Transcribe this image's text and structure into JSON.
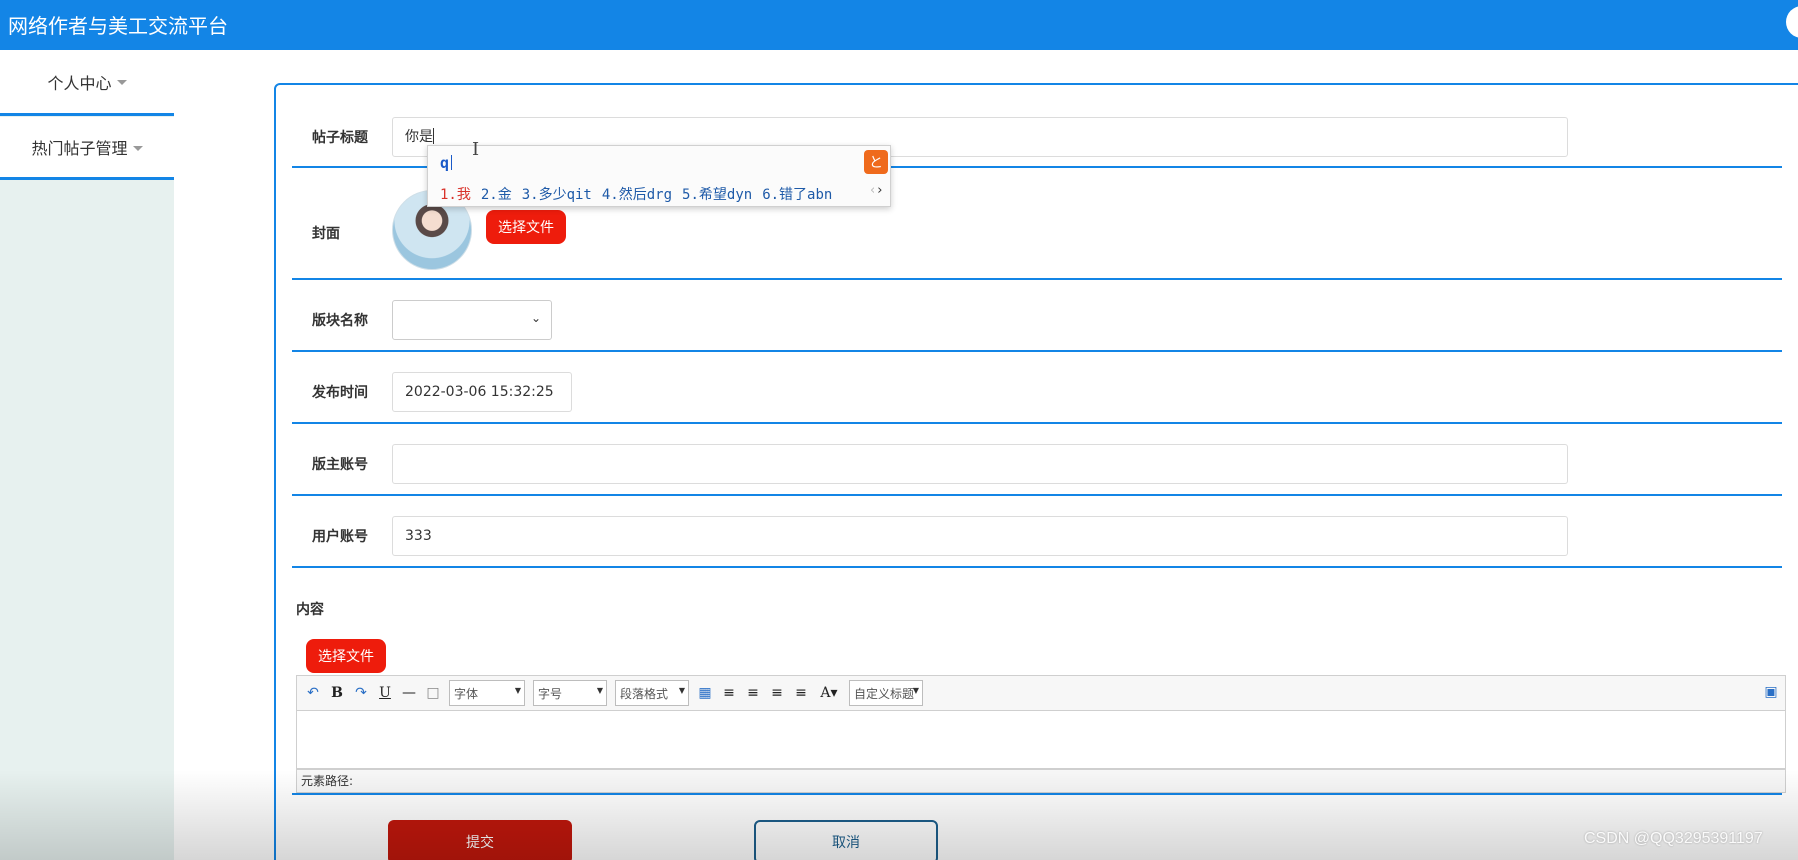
{
  "header": {
    "title": "网络作者与美工交流平台"
  },
  "sidebar": {
    "items": [
      {
        "label": "个人中心"
      },
      {
        "label": "热门帖子管理"
      }
    ]
  },
  "form": {
    "title": {
      "label": "帖子标题",
      "value": "你是"
    },
    "cover": {
      "label": "封面",
      "button": "选择文件"
    },
    "section": {
      "label": "版块名称",
      "value": ""
    },
    "publish_time": {
      "label": "发布时间",
      "value": "2022-03-06 15:32:25"
    },
    "moderator": {
      "label": "版主账号",
      "value": ""
    },
    "user": {
      "label": "用户账号",
      "value": "333"
    },
    "content": {
      "label": "内容",
      "button": "选择文件"
    }
  },
  "editor": {
    "font_family": "字体",
    "font_size": "字号",
    "paragraph": "段落格式",
    "custom_title": "自定义标题",
    "path_label": "元素路径:"
  },
  "actions": {
    "submit": "提交",
    "cancel": "取消"
  },
  "ime": {
    "input": "q",
    "candidates": [
      "1.我",
      "2.金",
      "3.多少qit",
      "4.然后drg",
      "5.希望dyn",
      "6.错了abn"
    ]
  },
  "watermark": "CSDN @QQ3295391197",
  "colors": {
    "primary": "#1385e6",
    "danger": "#ee1c0c",
    "sidebar_bg": "#e7f1ef"
  }
}
